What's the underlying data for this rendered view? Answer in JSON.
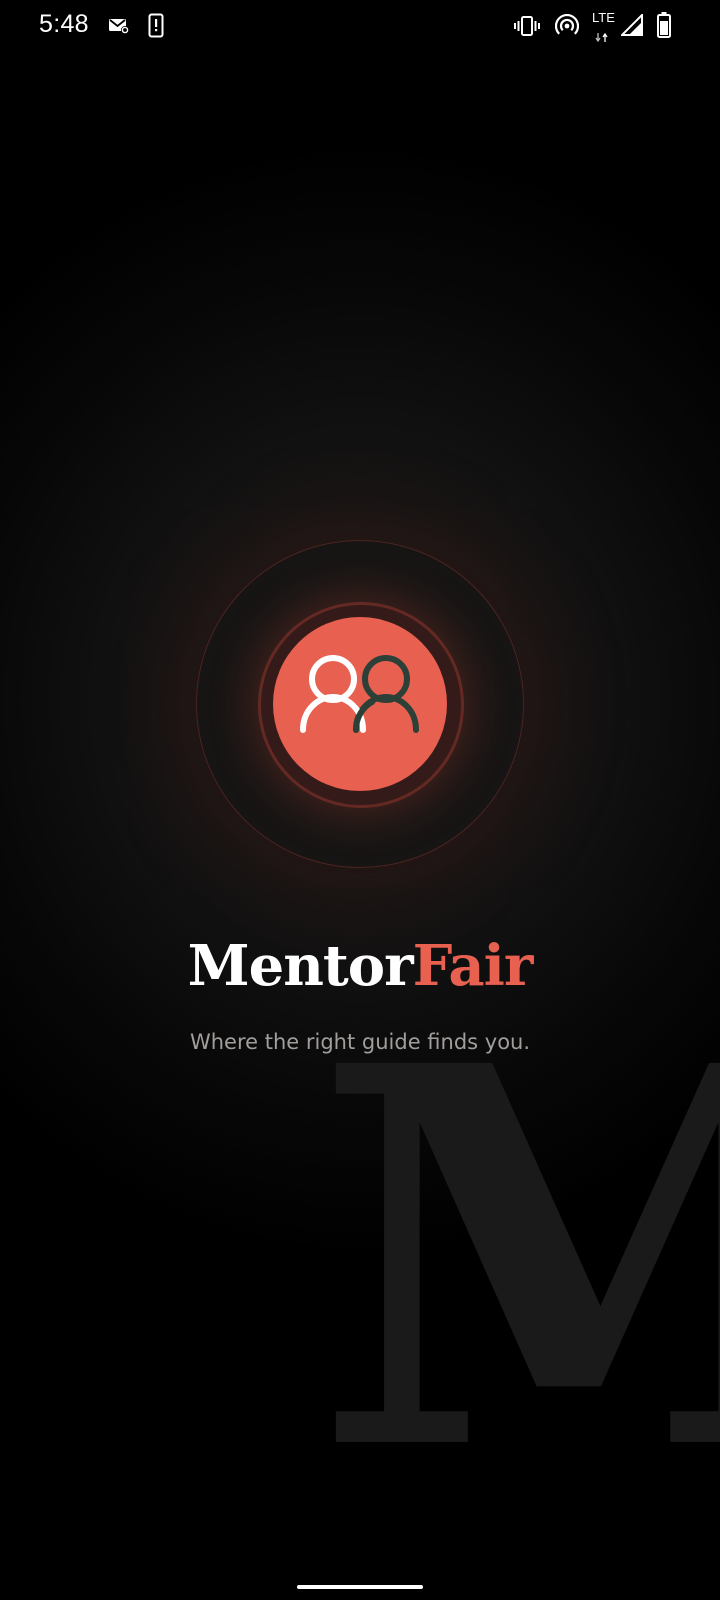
{
  "status_bar": {
    "time": "5:48",
    "network_type": "LTE",
    "icons": [
      "mail-icon",
      "device-alert-icon",
      "vibrate-icon",
      "hotspot-icon",
      "lte-data-icon",
      "cell-signal-icon",
      "battery-icon"
    ]
  },
  "logo": {
    "icon": "people-icon"
  },
  "brand": {
    "name_part_1": "Mentor",
    "name_part_2": "Fair",
    "tagline": "Where the right guide finds you.",
    "watermark": "M"
  },
  "colors": {
    "accent": "#e8604f",
    "dark_green": "#2c4038",
    "background": "#000000",
    "tagline": "#a19e9c"
  }
}
